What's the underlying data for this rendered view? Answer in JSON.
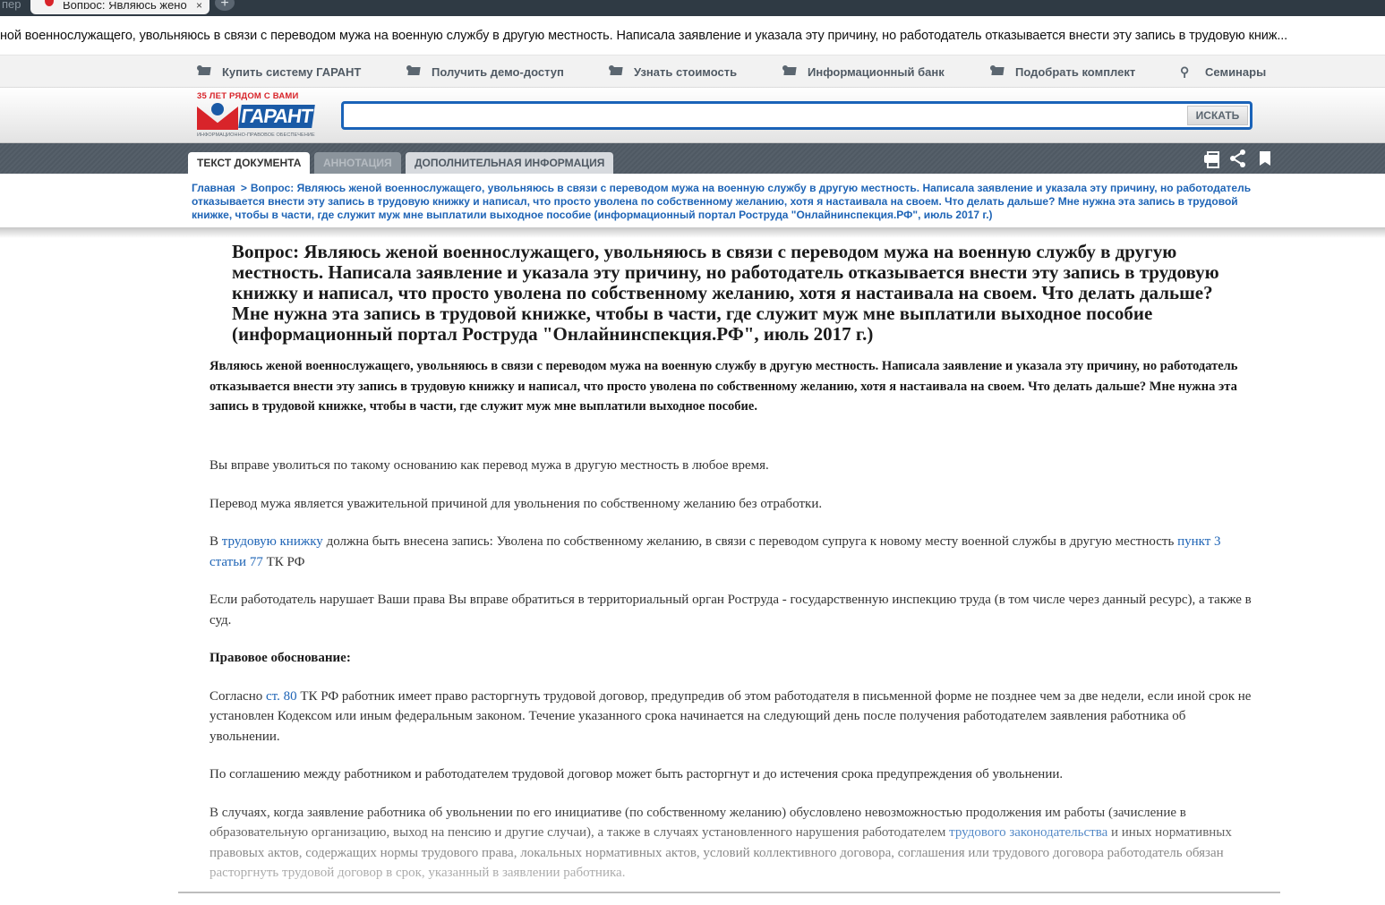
{
  "browser": {
    "prev_tab_label": "пер",
    "active_tab_title": "Вопрос: Являюсь жено",
    "close_glyph": "×",
    "new_tab_glyph": "+"
  },
  "page_title_bar": "ной военнослужащего, увольняюсь в связи с переводом мужа на военную службу в другую местность. Написала заявление и указала эту причину, но работодатель отказывается внести эту запись в трудовую книж...",
  "topnav": {
    "items": [
      {
        "label": "Купить систему ГАРАНТ",
        "icon": "monitor-icon"
      },
      {
        "label": "Получить демо-доступ",
        "icon": "monitor-icon"
      },
      {
        "label": "Узнать стоимость",
        "icon": "monitor-icon"
      },
      {
        "label": "Информационный банк",
        "icon": "monitor-icon"
      },
      {
        "label": "Подобрать комплект",
        "icon": "monitor-icon"
      },
      {
        "label": "Семинары",
        "icon": "satellite-dish-icon"
      }
    ]
  },
  "logo": {
    "tagline": "35 ЛЕТ РЯДОМ С ВАМИ",
    "wordmark": "ГАРАНТ",
    "subtitle": "ИНФОРМАЦИОННО-ПРАВОВОЕ ОБЕСПЕЧЕНИЕ"
  },
  "search": {
    "value": "",
    "placeholder": "",
    "button_label": "ИСКАТЬ"
  },
  "doc_tabs": [
    {
      "label": "ТЕКСТ ДОКУМЕНТА",
      "state": "active"
    },
    {
      "label": "АННОТАЦИЯ",
      "state": "disabled"
    },
    {
      "label": "ДОПОЛНИТЕЛЬНАЯ ИНФОРМАЦИЯ",
      "state": "normal"
    }
  ],
  "doc_actions": [
    "print-icon",
    "share-icon",
    "bookmark-icon"
  ],
  "breadcrumb": {
    "home": "Главная",
    "separator": ">",
    "current": "Вопрос: Являюсь женой военнослужащего, увольняюсь в связи с переводом мужа на военную службу в другую местность. Написала заявление и указала эту причину, но работодатель отказывается внести эту запись в трудовую книжку и написал, что просто уволена по собственному желанию, хотя я настаивала на своем. Что делать дальше? Мне нужна эта запись в трудовой книжке, чтобы в части, где служит муж мне выплатили выходное пособие (информационный портал Роструда \"Онлайнинспекция.РФ\", июль 2017 г.)"
  },
  "article": {
    "title": "Вопрос: Являюсь женой военнослужащего, увольняюсь в связи с переводом мужа на военную службу в другую местность. Написала заявление и указала эту причину, но работодатель отказывается внести эту запись в трудовую книжку и написал, что просто уволена по собственному желанию, хотя я настаивала на своем. Что делать дальше? Мне нужна эта запись в трудовой книжке, чтобы в части, где служит муж мне выплатили выходное пособие (информационный портал Роструда \"Онлайнинспекция.РФ\", июль 2017 г.)",
    "lead": "Являюсь женой военнослужащего, увольняюсь в связи с переводом мужа на военную службу в другую местность. Написала заявление и указала эту причину, но работодатель отказывается внести эту запись в трудовую книжку и написал, что просто уволена по собственному желанию, хотя я настаивала на своем. Что делать дальше? Мне нужна эта запись в трудовой книжке, чтобы в части, где служит муж мне выплатили выходное пособие.",
    "p1": "Вы вправе уволиться по такому основанию как перевод мужа в другую местность в любое время.",
    "p2": "Перевод мужа является уважительной причиной для увольнения по собственному желанию без отработки.",
    "p3_a": "В ",
    "p3_link1": "трудовую книжку",
    "p3_b": " должна быть внесена запись: Уволена по собственному желанию, в связи с переводом супруга к новому месту военной службы в другую местность ",
    "p3_link2": "пункт 3 статьи 77",
    "p3_c": " ТК РФ",
    "p4": "Если работодатель нарушает Ваши права Вы вправе обратиться в территориальный орган Роструда - государственную инспекцию труда (в том числе через данный ресурс), а также в суд.",
    "p5_heading": "Правовое обоснование:",
    "p6_a": "Согласно ",
    "p6_link": "ст. 80",
    "p6_b": " ТК РФ работник имеет право расторгнуть трудовой договор, предупредив об этом работодателя в письменной форме не позднее чем за две недели, если иной срок не установлен Кодексом или иным федеральным законом. Течение указанного срока начинается на следующий день после получения работодателем заявления работника об увольнении.",
    "p7": "По соглашению между работником и работодателем трудовой договор может быть расторгнут и до истечения срока предупреждения об увольнении.",
    "p8_a": "В случаях, когда заявление работника об увольнении по его инициативе (по собственному желанию) обусловлено невозможностью продолжения им работы (зачисление в образовательную организацию, выход на пенсию и другие случаи), а также в случаях установленного нарушения работодателем ",
    "p8_link": "трудового законодательства",
    "p8_b": " и иных нормативных правовых актов, содержащих нормы трудового права, локальных нормативных актов, условий коллективного договора, соглашения или трудового договора работодатель обязан расторгнуть трудовой договор в срок, указанный в заявлении работника."
  }
}
